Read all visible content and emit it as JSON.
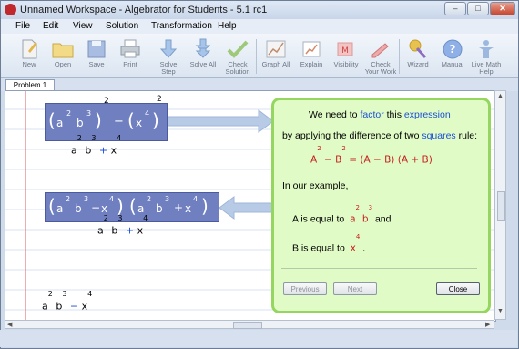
{
  "window": {
    "title": "Unnamed Workspace - Algebrator for Students - 5.1 rc1"
  },
  "menu": [
    "File",
    "Edit",
    "View",
    "Solution",
    "Transformation",
    "Help"
  ],
  "toolbar": {
    "new": "New",
    "open": "Open",
    "save": "Save",
    "print": "Print",
    "solve_step": [
      "Solve",
      "Step"
    ],
    "solve_all": "Solve All",
    "check_solution": [
      "Check",
      "Solution"
    ],
    "graph_all": "Graph All",
    "explain": "Explain",
    "visibility": "Visibility",
    "check_your_work": [
      "Check",
      "Your Work"
    ],
    "wizard": "Wizard",
    "manual": "Manual",
    "live_math_help": [
      "Live Math",
      "Help"
    ]
  },
  "tab": "Problem 1",
  "expr1": {
    "a": "a",
    "two1": "2",
    "b": "b",
    "three": "3",
    "minus": "−",
    "x": "x",
    "four": "4",
    "two2": "2",
    "two3": "2"
  },
  "expr2": {
    "a": "a",
    "two": "2",
    "b": "b",
    "three": "3",
    "plus": "+",
    "x": "x",
    "four": "4"
  },
  "expr3": {
    "a": "a",
    "two": "2",
    "b": "b",
    "three": "3",
    "minus": "−",
    "x": "x",
    "four": "4",
    "plus": "+"
  },
  "expr4": {
    "a": "a",
    "two": "2",
    "b": "b",
    "three": "3",
    "plus": "+",
    "x": "x",
    "four": "4"
  },
  "expr5": {
    "a": "a",
    "two": "2",
    "b": "b",
    "three": "3",
    "minus": "−",
    "x": "x",
    "four": "4"
  },
  "panel": {
    "line1_a": "We need to",
    "line1_factor": "factor",
    "line1_b": "this",
    "line1_expr": "expression",
    "line2_a": "by applying the difference of two",
    "line2_squares": "squares",
    "line2_b": "rule:",
    "rule": {
      "A": "A",
      "two": "2",
      "minus": "−",
      "B": "B",
      "eq": "=",
      "rhs": "(A − B)  (A + B)"
    },
    "example": "In our example,",
    "a_is": "A is equal to",
    "a_val_a": "a",
    "a_val_2": "2",
    "a_val_b": "b",
    "a_val_3": "3",
    "and": "and",
    "b_is": "B is equal to",
    "b_val_x": "x",
    "b_val_4": "4",
    "period": ".",
    "previous": "Previous",
    "next": "Next",
    "close": "Close"
  },
  "colors": {
    "accent": "#1a4fd6",
    "red": "#c62020",
    "panel_bg": "#e0fbc6",
    "panel_border": "#95d65e",
    "box": "#6f7fc0"
  }
}
